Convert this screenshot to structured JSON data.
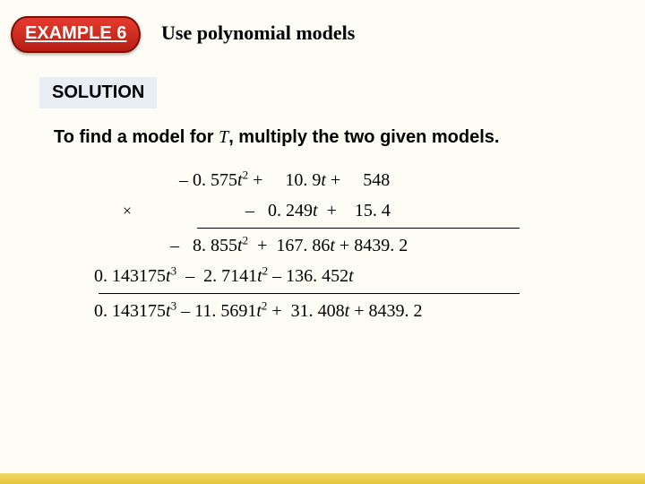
{
  "header": {
    "badge": "EXAMPLE 6",
    "title": "Use polynomial models"
  },
  "solution_label": "SOLUTION",
  "lead": {
    "pre": "To find a model for ",
    "var": "T",
    "post": ", multiply the two given models."
  },
  "math": {
    "poly1": {
      "a": "– 0. 575",
      "b": "10. 9",
      "c": "548"
    },
    "poly2": {
      "b": "0. 249",
      "b_sign": "–",
      "c": "15. 4"
    },
    "partial1": {
      "a2": "8. 855",
      "a2_sign": "–",
      "a1": "167. 86",
      "a0": "8439. 2"
    },
    "partial2": {
      "a3": "0. 143175",
      "a2": "2. 7141",
      "a2_sign": "–",
      "a1": "136. 452",
      "a1_sign": "–"
    },
    "result": {
      "a3": "0. 143175",
      "a2": "11. 5691",
      "a2_sign": "–",
      "a1": "31. 408",
      "a1_sign": "+",
      "a0": "8439. 2"
    }
  }
}
